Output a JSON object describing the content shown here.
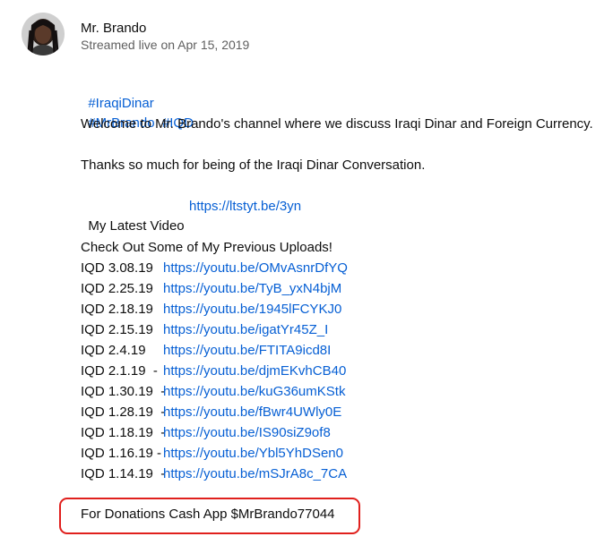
{
  "channel": {
    "name": "Mr. Brando",
    "streamed": "Streamed live on Apr 15, 2019"
  },
  "hashtags": [
    "#IraqiDinar",
    "#MrBrando",
    "#IQD"
  ],
  "welcome": "Welcome to Mr. Brando's channel where we discuss Iraqi Dinar and Foreign Currency.",
  "thanks": "Thanks so much for being of the Iraqi Dinar Conversation.",
  "latest": {
    "label": "My Latest Video",
    "url": "https://ltstyt.be/3yn"
  },
  "previous_heading": "Check Out Some of My Previous Uploads!",
  "uploads": [
    {
      "label": "IQD 3.08.19",
      "url": "https://youtu.be/OMvAsnrDfYQ"
    },
    {
      "label": "IQD 2.25.19",
      "url": "https://youtu.be/TyB_yxN4bjM"
    },
    {
      "label": "IQD 2.18.19",
      "url": "https://youtu.be/1945lFCYKJ0"
    },
    {
      "label": "IQD 2.15.19",
      "url": "https://youtu.be/igatYr45Z_I"
    },
    {
      "label": "IQD 2.4.19",
      "url": "https://youtu.be/FTITA9icd8I"
    },
    {
      "label": "IQD 2.1.19  -",
      "url": "https://youtu.be/djmEKvhCB40"
    },
    {
      "label": "IQD 1.30.19  -",
      "url": "https://youtu.be/kuG36umKStk"
    },
    {
      "label": "IQD 1.28.19  -",
      "url": "https://youtu.be/fBwr4UWly0E"
    },
    {
      "label": "IQD 1.18.19  -",
      "url": "https://youtu.be/IS90siZ9of8"
    },
    {
      "label": "IQD 1.16.19 -",
      "url": "https://youtu.be/Ybl5YhDSen0"
    },
    {
      "label": "IQD 1.14.19  -",
      "url": "https://youtu.be/mSJrA8c_7CA"
    }
  ],
  "donation": "For Donations Cash App $MrBrando77044",
  "colors": {
    "link": "#065fd4",
    "highlight_border": "#e0201d",
    "secondary_text": "#606060"
  }
}
